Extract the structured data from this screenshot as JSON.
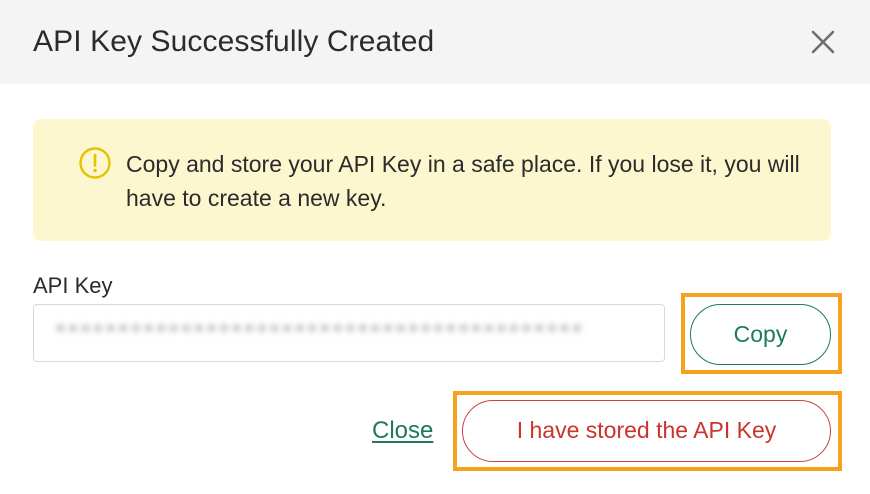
{
  "dialog": {
    "title": "API Key Successfully Created",
    "close_icon": "close-icon"
  },
  "alert": {
    "icon": "warning-circle-icon",
    "message": "Copy and store your API Key in a safe place. If you lose it, you will have to create a new key.",
    "background_color": "#fcf7cf",
    "icon_color": "#e2c400"
  },
  "api_key": {
    "label": "API Key",
    "value": "••••••••••••••••••••••••••••••••••••••••••"
  },
  "buttons": {
    "copy_label": "Copy",
    "close_label": "Close",
    "stored_label": "I have stored the API Key"
  },
  "colors": {
    "primary_green": "#1e7a5a",
    "danger_red": "#c9342d",
    "highlight_orange": "#f6a21e"
  }
}
